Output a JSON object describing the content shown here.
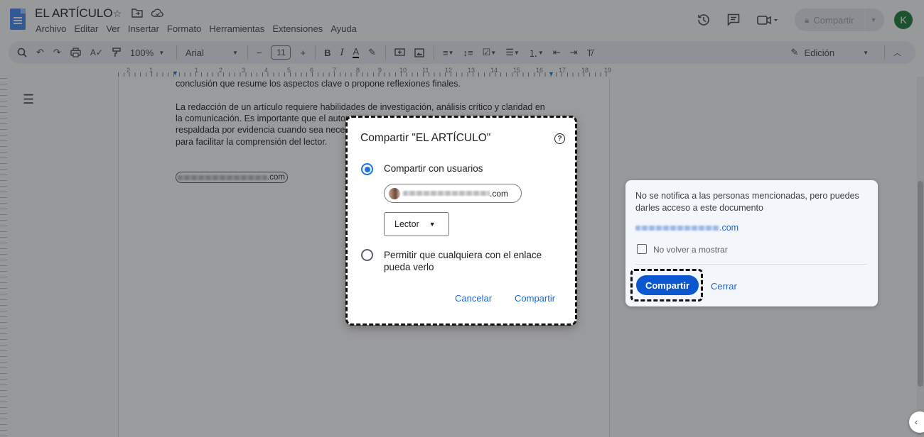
{
  "header": {
    "title": "EL ARTÍCULO",
    "menu": [
      "Archivo",
      "Editar",
      "Ver",
      "Insertar",
      "Formato",
      "Herramientas",
      "Extensiones",
      "Ayuda"
    ],
    "share_label": "Compartir",
    "avatar_letter": "K"
  },
  "toolbar": {
    "zoom": "100%",
    "font": "Arial",
    "font_size": "11",
    "mode": "Edición"
  },
  "ruler": {
    "labels": [
      "2",
      "1",
      "1",
      "2",
      "3",
      "4",
      "5",
      "6",
      "7",
      "8",
      "9",
      "10",
      "11",
      "12",
      "13",
      "14",
      "15",
      "16",
      "17",
      "18",
      "19"
    ]
  },
  "document": {
    "lines": [
      "conclusión que resume los aspectos clave o propone reflexiones finales.",
      "La redacción de un artículo requiere habilidades de investigación, análisis crítico y claridad en",
      "la comunicación. Es importante que el autor",
      "respaldada por evidencia cuando sea nece",
      "para facilitar la comprensión del lector."
    ],
    "mention_suffix": ".com"
  },
  "dialog": {
    "title": "Compartir \"EL ARTÍCULO\"",
    "option_users": "Compartir con usuarios",
    "user_email_suffix": ".com",
    "role": "Lector",
    "option_link_line1": "Permitir que cualquiera con el enlace",
    "option_link_line2": "pueda verlo",
    "cancel": "Cancelar",
    "share": "Compartir"
  },
  "popup": {
    "message": "No se notifica a las personas mencionadas, pero puedes darles acceso a este documento",
    "email_suffix": ".com",
    "checkbox_label": "No volver a mostrar",
    "share": "Compartir",
    "close": "Cerrar"
  },
  "colors": {
    "accent": "#1a73e8",
    "primary_button": "#0b57d0",
    "avatar": "#1a7a3b"
  }
}
